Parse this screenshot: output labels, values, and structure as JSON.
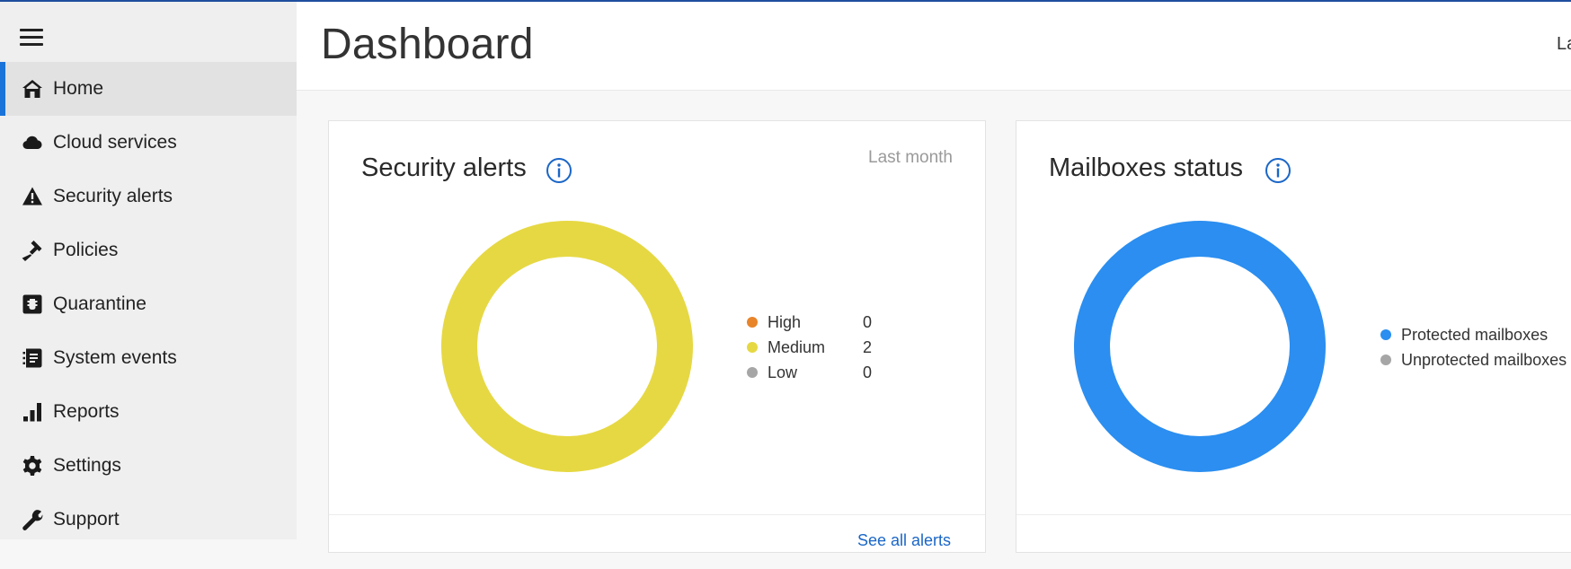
{
  "colors": {
    "accent": "#1a73d9",
    "high": "#e8842a",
    "medium": "#e6d843",
    "low": "#a6a6a6",
    "protected": "#2b8ef0",
    "unprotected": "#a6a6a6"
  },
  "sidebar": {
    "items": [
      {
        "label": "Home",
        "icon": "home-icon",
        "active": true
      },
      {
        "label": "Cloud services",
        "icon": "cloud-icon"
      },
      {
        "label": "Security alerts",
        "icon": "warning-icon"
      },
      {
        "label": "Policies",
        "icon": "gavel-icon"
      },
      {
        "label": "Quarantine",
        "icon": "quarantine-icon"
      },
      {
        "label": "System events",
        "icon": "system-events-icon"
      },
      {
        "label": "Reports",
        "icon": "reports-icon"
      },
      {
        "label": "Settings",
        "icon": "gear-icon"
      },
      {
        "label": "Support",
        "icon": "wrench-icon"
      }
    ]
  },
  "header": {
    "title": "Dashboard",
    "right_text": "La"
  },
  "security_alerts": {
    "title": "Security alerts",
    "range": "Last month",
    "legend": [
      {
        "name": "High",
        "value": "0"
      },
      {
        "name": "Medium",
        "value": "2"
      },
      {
        "name": "Low",
        "value": "0"
      }
    ],
    "footer_link": "See all alerts"
  },
  "mailboxes": {
    "title": "Mailboxes status",
    "legend": [
      {
        "name": "Protected mailboxes"
      },
      {
        "name": "Unprotected mailboxes"
      }
    ]
  }
}
